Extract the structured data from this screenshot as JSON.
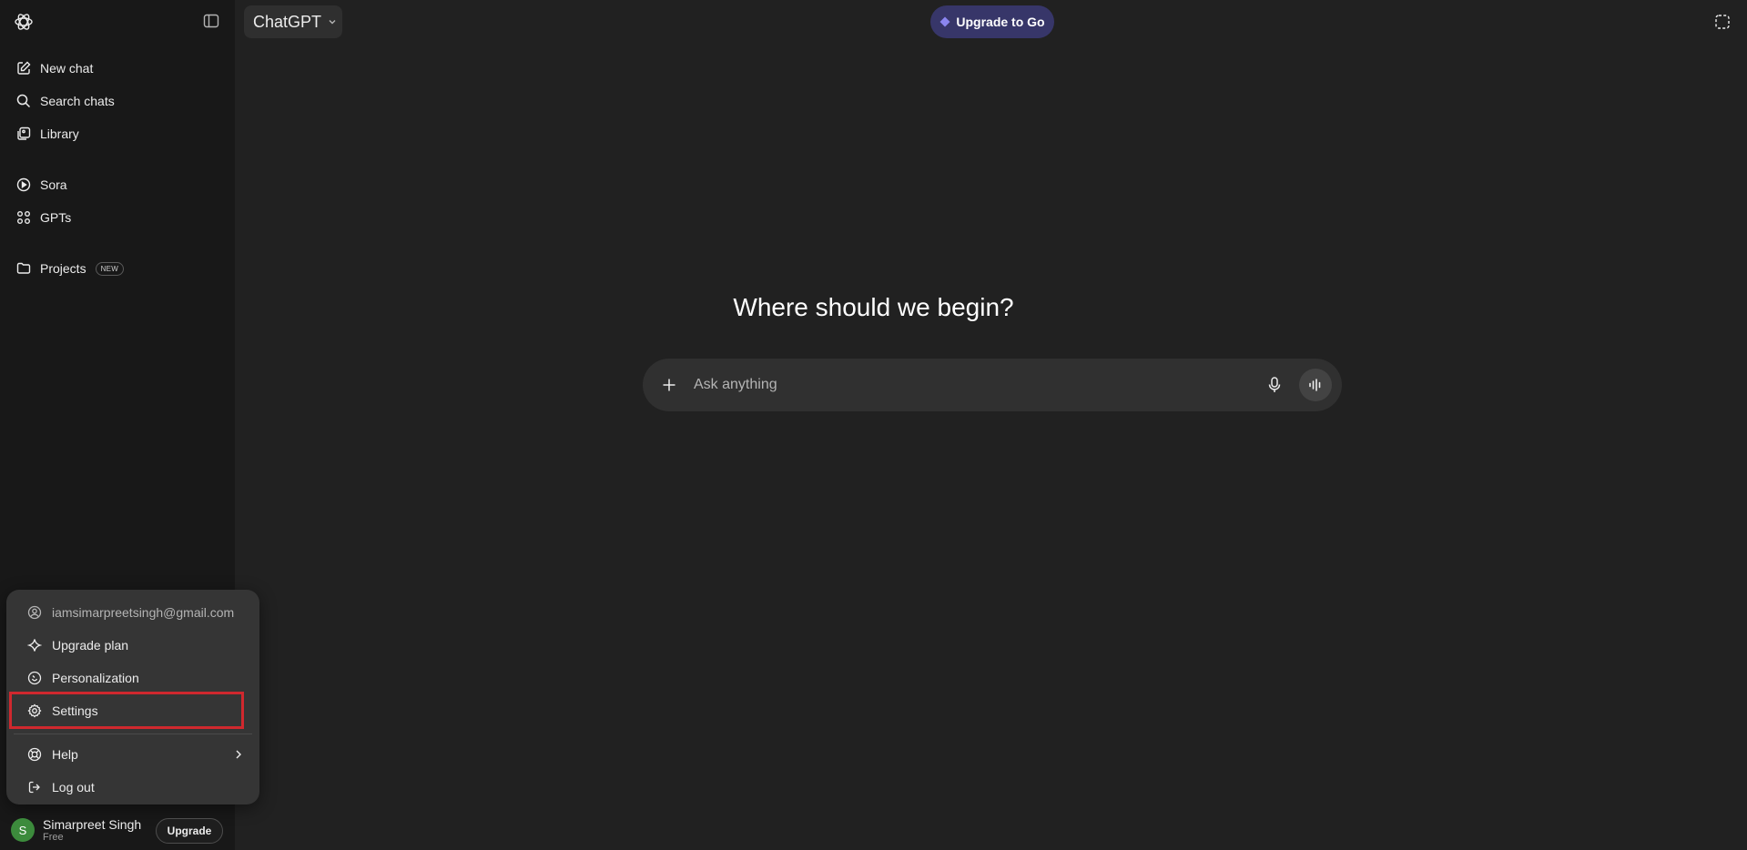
{
  "colors": {
    "background": "#212121",
    "sidebar": "#181818",
    "menu": "#353535",
    "upgrade_accent": "#373669",
    "highlight": "#d0282e",
    "avatar": "#3c8b3c"
  },
  "sidebar": {
    "logo_icon": "openai-logo-icon",
    "toggle_icon": "sidebar-toggle-icon",
    "items": [
      {
        "label": "New chat",
        "icon": "pencil-square-icon"
      },
      {
        "label": "Search chats",
        "icon": "search-icon"
      },
      {
        "label": "Library",
        "icon": "images-icon"
      },
      {
        "label": "Sora",
        "icon": "play-circle-icon"
      },
      {
        "label": "GPTs",
        "icon": "grid-icon"
      },
      {
        "label": "Projects",
        "icon": "folder-icon",
        "badge": "NEW"
      }
    ]
  },
  "header": {
    "model_label": "ChatGPT",
    "upgrade_label": "Upgrade to Go",
    "temporary_chat_icon": "dashed-square-icon"
  },
  "main": {
    "headline": "Where should we begin?",
    "composer": {
      "placeholder": "Ask anything",
      "value": ""
    }
  },
  "menu": {
    "email": "iamsimarpreetsingh@gmail.com",
    "upgrade_plan": "Upgrade plan",
    "personalization": "Personalization",
    "settings": "Settings",
    "help": "Help",
    "logout": "Log out"
  },
  "user": {
    "initial": "S",
    "name": "Simarpreet Singh",
    "plan": "Free",
    "upgrade_label": "Upgrade"
  }
}
